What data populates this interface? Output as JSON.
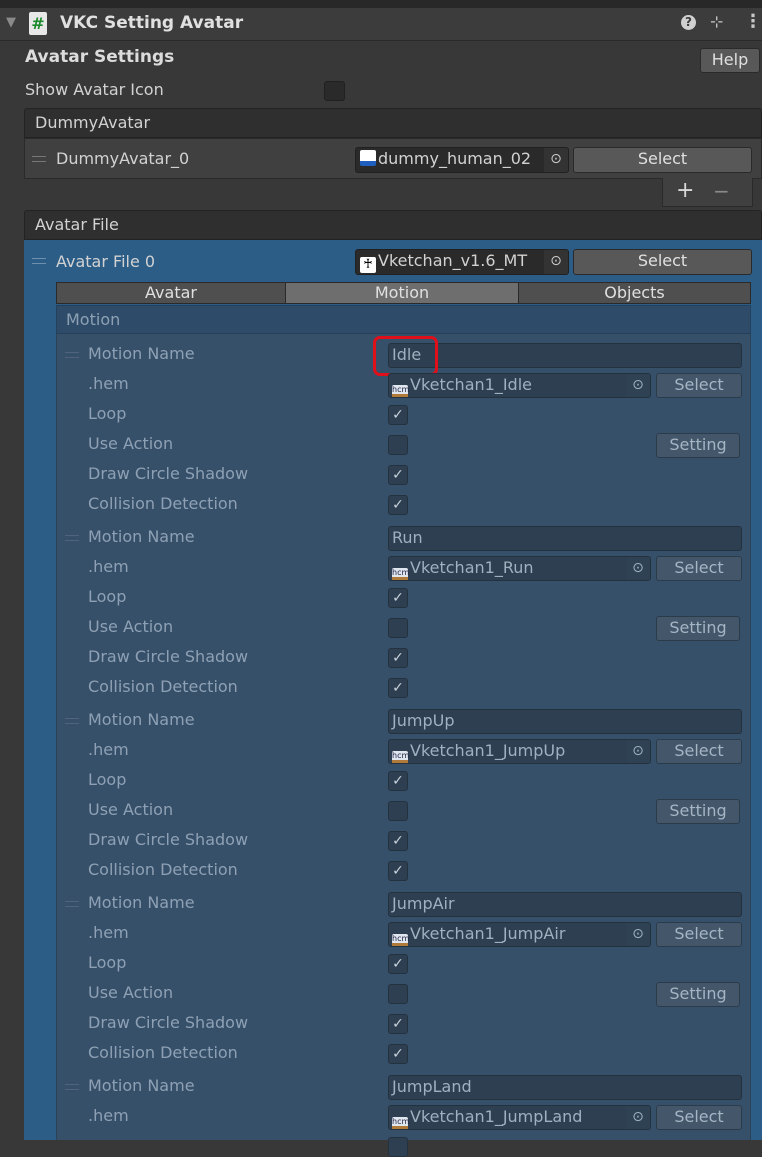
{
  "component": {
    "title": "VKC Setting Avatar",
    "icon": "csharp-script-icon",
    "icons": [
      "help-icon",
      "preset-icon",
      "more-menu-icon"
    ]
  },
  "avatar_settings": {
    "heading": "Avatar Settings",
    "help_label": "Help",
    "show_icon_label": "Show Avatar Icon",
    "show_icon_checked": false
  },
  "dummy_avatar": {
    "header": "DummyAvatar",
    "items": [
      {
        "label": "DummyAvatar_0",
        "value": "dummy_human_02",
        "select_label": "Select"
      }
    ],
    "add_label": "+",
    "remove_label": "−"
  },
  "avatar_file": {
    "header": "Avatar File",
    "item": {
      "label": "Avatar File 0",
      "value": "Vketchan_v1.6_MT",
      "select_label": "Select"
    }
  },
  "tabs": [
    {
      "label": "Avatar",
      "selected": false
    },
    {
      "label": "Motion",
      "selected": true
    },
    {
      "label": "Objects",
      "selected": false
    }
  ],
  "motion": {
    "header": "Motion",
    "labels": {
      "name": "Motion Name",
      "hem": ".hem",
      "loop": "Loop",
      "use_action": "Use Action",
      "shadow": "Draw Circle Shadow",
      "collision": "Collision Detection",
      "select": "Select",
      "setting": "Setting"
    },
    "items": [
      {
        "name": "Idle",
        "hem": "Vketchan1_Idle",
        "loop": true,
        "use_action": false,
        "shadow": true,
        "collision": true,
        "highlighted": true
      },
      {
        "name": "Run",
        "hem": "Vketchan1_Run",
        "loop": true,
        "use_action": false,
        "shadow": true,
        "collision": true
      },
      {
        "name": "JumpUp",
        "hem": "Vketchan1_JumpUp",
        "loop": true,
        "use_action": false,
        "shadow": true,
        "collision": true
      },
      {
        "name": "JumpAir",
        "hem": "Vketchan1_JumpAir",
        "loop": true,
        "use_action": false,
        "shadow": true,
        "collision": true
      },
      {
        "name": "JumpLand",
        "hem": "Vketchan1_JumpLand"
      }
    ]
  },
  "colors": {
    "selected_blue": "#2c5d87",
    "highlight": "#e0101a"
  }
}
